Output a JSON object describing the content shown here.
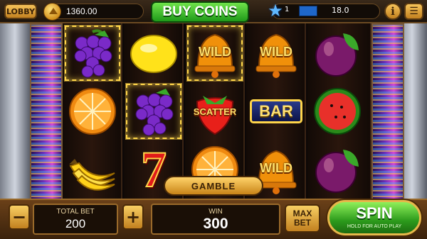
{
  "topbar": {
    "lobby_label": "LOBBY",
    "coins": "1360.00",
    "buy_coins_label": "BUY COINS",
    "level": "1",
    "xp_value": "18.0",
    "info_icon": "i",
    "menu_icon": "☰"
  },
  "reels": {
    "columns": [
      [
        "grapes",
        "orange",
        "banana"
      ],
      [
        "lemon",
        "grapes",
        "seven"
      ],
      [
        "wild-bell",
        "strawberry-scatter",
        "orange"
      ],
      [
        "wild-bell",
        "bar",
        "wild-bell"
      ],
      [
        "plum",
        "watermelon",
        "plum"
      ]
    ],
    "wild_text": "WILD",
    "scatter_text": "SCATTER",
    "bar_text": "BAR",
    "seven_text": "7"
  },
  "gamble_label": "GAMBLE",
  "bottom": {
    "minus_label": "−",
    "plus_label": "+",
    "total_bet_label": "TOTAL BET",
    "total_bet_value": "200",
    "win_label": "WIN",
    "win_value": "300",
    "max_bet_line1": "MAX",
    "max_bet_line2": "BET",
    "spin_label": "SPIN",
    "spin_sub": "HOLD FOR AUTO PLAY"
  },
  "colors": {
    "buy_green": "#1f9a1a",
    "gold": "#ffd54a",
    "wild_gold": "#ffdf6a"
  }
}
